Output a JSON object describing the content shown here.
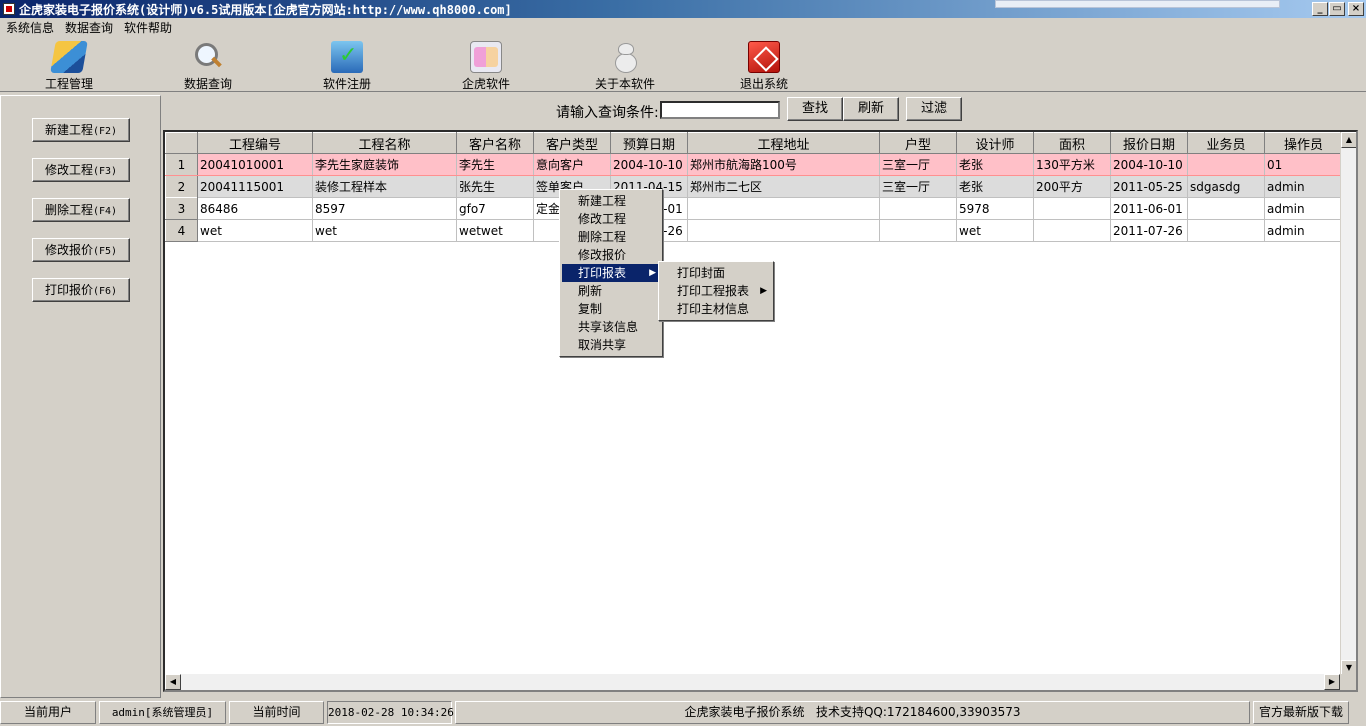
{
  "window": {
    "title": "企虎家装电子报价系统(设计师)v6.5试用版本[企虎官方网站:http://www.qh8000.com]",
    "controls": [
      "_",
      "▭",
      "×"
    ]
  },
  "menubar": [
    "系统信息",
    "数据查询",
    "软件帮助"
  ],
  "toolbar": [
    {
      "label": "工程管理",
      "icon": "project-icon"
    },
    {
      "label": "数据查询",
      "icon": "magnifier-icon"
    },
    {
      "label": "软件注册",
      "icon": "register-icon"
    },
    {
      "label": "企虎软件",
      "icon": "qihu-software-icon"
    },
    {
      "label": "关于本软件",
      "icon": "about-icon"
    },
    {
      "label": "退出系统",
      "icon": "exit-icon"
    }
  ],
  "side_buttons": [
    {
      "label": "新建工程",
      "key": "(F2)"
    },
    {
      "label": "修改工程",
      "key": "(F3)"
    },
    {
      "label": "删除工程",
      "key": "(F4)"
    },
    {
      "label": "修改报价",
      "key": "(F5)"
    },
    {
      "label": "打印报价",
      "key": "(F6)"
    }
  ],
  "search": {
    "label": "请输入查询条件:",
    "value": "",
    "buttons": [
      "查找",
      "刷新",
      "过滤"
    ]
  },
  "table": {
    "columns": [
      "",
      "工程编号",
      "工程名称",
      "客户名称",
      "客户类型",
      "预算日期",
      "工程地址",
      "户型",
      "设计师",
      "面积",
      "报价日期",
      "业务员",
      "操作员"
    ],
    "rows": [
      [
        "1",
        "20041010001",
        "李先生家庭装饰",
        "李先生",
        "意向客户",
        "2004-10-10",
        "郑州市航海路100号",
        "三室一厅",
        "老张",
        "130平方米",
        "2004-10-10",
        "",
        "01"
      ],
      [
        "2",
        "20041115001",
        "装修工程样本",
        "张先生",
        "签单客户",
        "2011-04-15",
        "郑州市二七区",
        "三室一厅",
        "老张",
        "200平方",
        "2011-05-25",
        "sdgasdg",
        "admin"
      ],
      [
        "3",
        "86486",
        "8597",
        "gfo7",
        "定金客户",
        "2011-06-01",
        "",
        "",
        "5978",
        "",
        "2011-06-01",
        "",
        "admin"
      ],
      [
        "4",
        "wet",
        "wet",
        "wetwet",
        "",
        "2011-07-26",
        "",
        "",
        "wet",
        "",
        "2011-07-26",
        "",
        "admin"
      ]
    ]
  },
  "context_menu": {
    "items": [
      "新建工程",
      "修改工程",
      "删除工程",
      "修改报价",
      "打印报表",
      "刷新",
      "复制",
      "共享该信息",
      "取消共享"
    ],
    "active": "打印报表",
    "submenu": [
      "打印封面",
      "打印工程报表",
      "打印主材信息"
    ]
  },
  "status": {
    "user_label": "当前用户",
    "user_value": "admin[系统管理员]",
    "time_label": "当前时间",
    "time_value": "2018-02-28 10:34:26",
    "info": "企虎家装电子报价系统   技术支持QQ:172184600,33903573",
    "download": "官方最新版下载"
  }
}
